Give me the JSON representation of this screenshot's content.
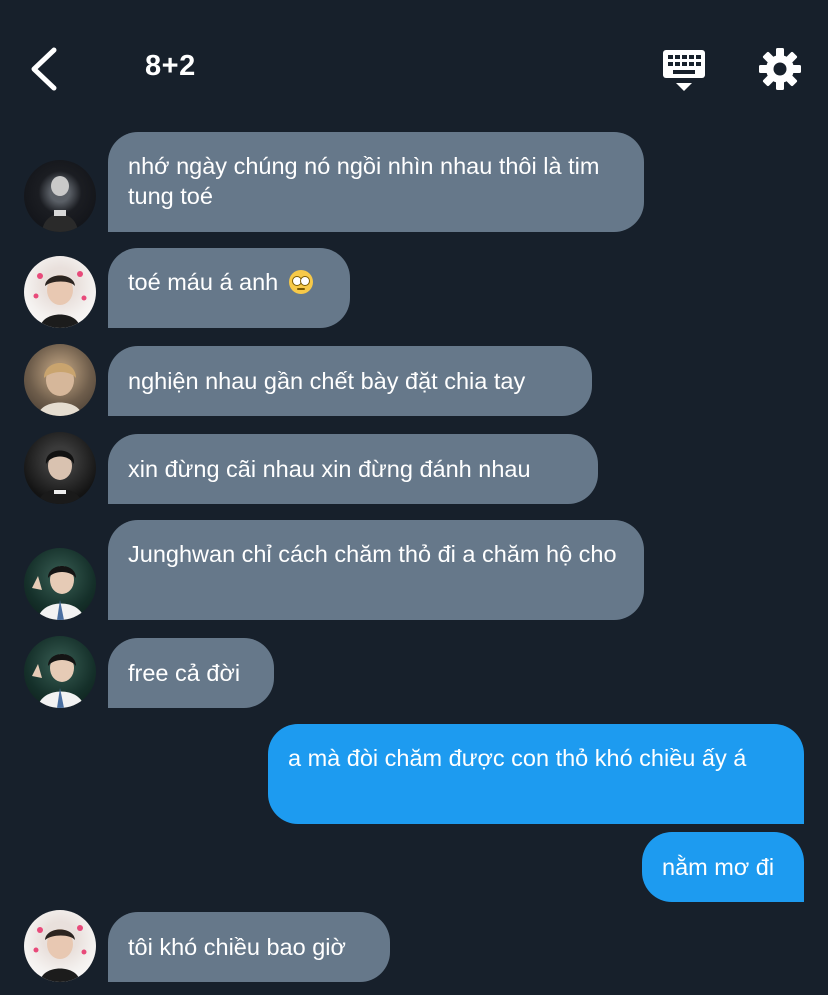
{
  "header": {
    "title": "8+2"
  },
  "messages": [
    {
      "from": "member-1",
      "text": "nhớ ngày chúng nó ngồi nhìn nhau thôi là tim tung toé"
    },
    {
      "from": "member-2",
      "text": "toé máu á anh",
      "emoji": "face-with-rolling-eyes"
    },
    {
      "from": "member-3",
      "text": "nghiện nhau gần chết bày đặt chia tay"
    },
    {
      "from": "member-4",
      "text": "xin đừng cãi nhau xin đừng đánh nhau"
    },
    {
      "from": "member-5",
      "text": "Junghwan chỉ cách chăm thỏ đi a chăm hộ cho"
    },
    {
      "from": "member-5",
      "text": "free cả đời"
    },
    {
      "from": "me",
      "text": "a mà đòi chăm được con thỏ khó chiều ấy á"
    },
    {
      "from": "me",
      "text": "nằm mơ đi"
    },
    {
      "from": "member-2",
      "text": "tôi khó chiều bao giờ"
    }
  ],
  "colors": {
    "background": "#17202b",
    "incoming_bubble": "#66788a",
    "outgoing_bubble": "#1d9bf0"
  },
  "icons": [
    "chevron-left-icon",
    "keyboard-icon",
    "gear-icon"
  ]
}
